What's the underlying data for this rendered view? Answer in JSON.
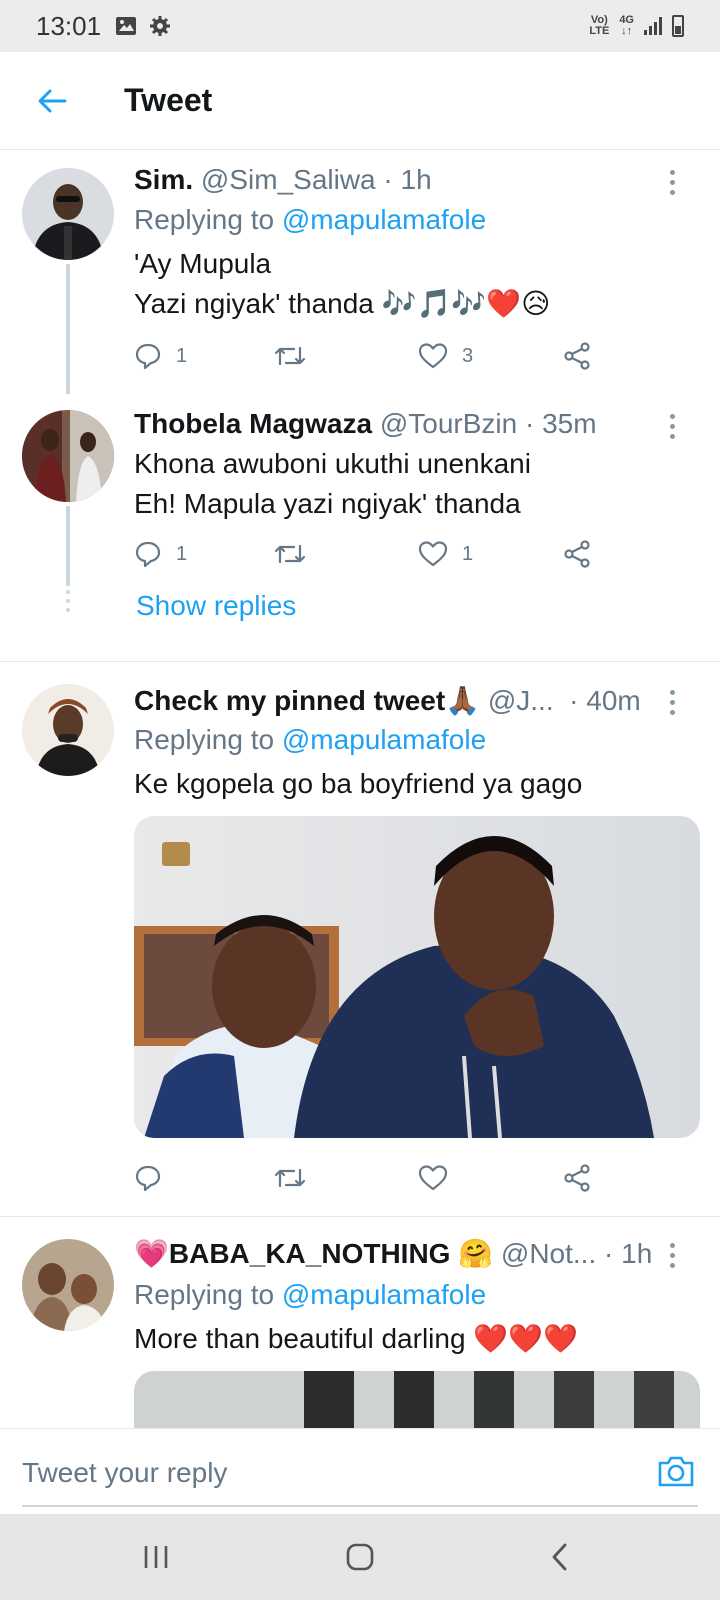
{
  "status_bar": {
    "time": "13:01",
    "network_top": "Vo)",
    "network_bottom": "LTE",
    "network_type": "4G",
    "icons": [
      "gallery-icon",
      "settings-gear-icon",
      "signal-icon",
      "battery-icon"
    ]
  },
  "header": {
    "title": "Tweet",
    "back_icon": "arrow-left-icon"
  },
  "colors": {
    "accent": "#1da1f2",
    "secondary_text": "#657786",
    "divider": "#e1e8ed"
  },
  "tweets": [
    {
      "name": "Sim.",
      "handle": "@Sim_Saliwa",
      "time": "· 1h",
      "replying_label": "Replying to",
      "replying_to": "@mapulamafole",
      "lines": [
        "'Ay  Mupula",
        "Yazi ngiyak' thanda"
      ],
      "emoji_tail": "🎶🎵🎶❤️😥",
      "replies": "1",
      "likes": "3"
    },
    {
      "name": "Thobela Magwaza",
      "handle": "@TourBzin",
      "time": "· 35m",
      "lines": [
        "Khona awuboni ukuthi unenkani",
        "Eh! Mapula yazi ngiyak' thanda"
      ],
      "replies": "1",
      "likes": "1",
      "show_replies": "Show replies"
    },
    {
      "name": "Check my pinned tweet",
      "name_emoji": "🙏🏾",
      "handle": "@J...",
      "time": "· 40m",
      "replying_label": "Replying to",
      "replying_to": "@mapulamafole",
      "text": "Ke kgopela go ba boyfriend ya gago"
    },
    {
      "name_emoji_lead": "💗",
      "name": "BABA_KA_NOTHING",
      "name_emoji": "🤗",
      "handle": "@Not...",
      "time": "· 1h",
      "replying_label": "Replying to",
      "replying_to": "@mapulamafole",
      "text": "More than beautiful darling",
      "emoji_tail": "❤️❤️❤️"
    }
  ],
  "reply_bar": {
    "placeholder": "Tweet your reply",
    "camera_icon": "camera-icon"
  },
  "nav_bar": {
    "icons": [
      "recents-icon",
      "home-icon",
      "back-icon"
    ]
  }
}
